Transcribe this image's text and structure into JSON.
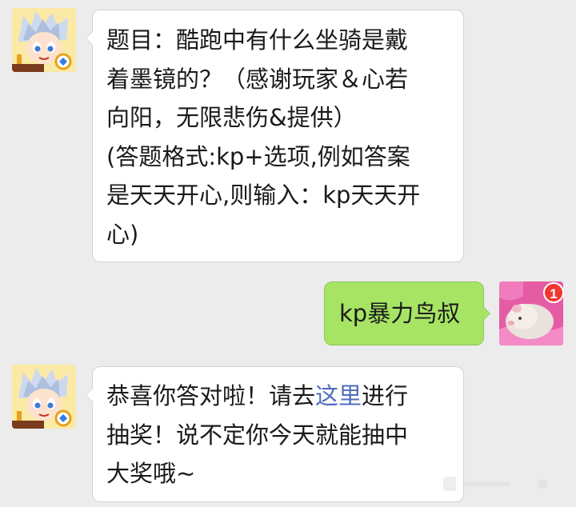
{
  "messages": [
    {
      "side": "left",
      "lines": [
        "题目：酷跑中有什么坐骑是戴",
        "着墨镜的？（感谢玩家＆心若",
        "向阳，无限悲伤&提供）",
        "(答题格式:kp+选项,例如答案",
        "是天天开心,则输入：kp天天开",
        "心)"
      ]
    },
    {
      "side": "right",
      "text": "kp暴力鸟叔",
      "badge": "1"
    },
    {
      "side": "left",
      "line1_before": "恭喜你答对啦！请去",
      "line1_link": "这里",
      "line1_after": "进行",
      "line2": "抽奖！说不定你今天就能抽中",
      "line3": "大奖哦~"
    }
  ],
  "colors": {
    "background": "#ececec",
    "left_bubble": "#ffffff",
    "right_bubble": "#a7e464",
    "link": "#4e6dbf",
    "badge": "#f43530"
  },
  "icons": {
    "game_avatar": "game-character-avatar-icon",
    "user_avatar": "hamster-avatar-icon",
    "game_logo": "tencent-game-logo-icon"
  }
}
